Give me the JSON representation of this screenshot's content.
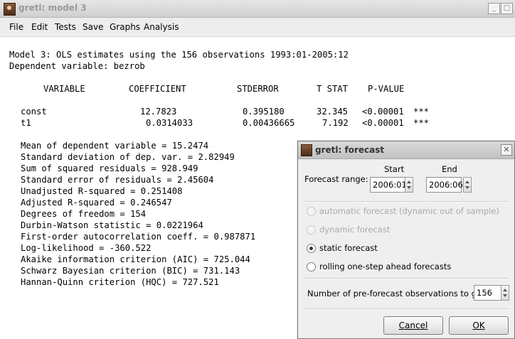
{
  "window": {
    "title": "gretl: model 3"
  },
  "menu": [
    "File",
    "Edit",
    "Tests",
    "Save",
    "Graphs",
    "Analysis"
  ],
  "output": {
    "header1": "Model 3: OLS estimates using the 156 observations 1993:01-2005:12",
    "header2": "Dependent variable: bezrob",
    "col_headers": [
      "VARIABLE",
      "COEFFICIENT",
      "STDERROR",
      "T STAT",
      "P-VALUE"
    ],
    "rows": [
      {
        "var": "const",
        "coef": "12.7823",
        "se": "0.395180",
        "t": "32.345",
        "p": "<0.00001",
        "sig": "***"
      },
      {
        "var": "t1",
        "coef": "0.0314033",
        "se": "0.00436665",
        "t": "7.192",
        "p": "<0.00001",
        "sig": "***"
      }
    ],
    "stats": [
      "Mean of dependent variable = 15.2474",
      "Standard deviation of dep. var. = 2.82949",
      "Sum of squared residuals = 928.949",
      "Standard error of residuals = 2.45604",
      "Unadjusted R-squared = 0.251408",
      "Adjusted R-squared = 0.246547",
      "Degrees of freedom = 154",
      "Durbin-Watson statistic = 0.0221964",
      "First-order autocorrelation coeff. = 0.987871",
      "Log-likelihood = -360.522",
      "Akaike information criterion (AIC) = 725.044",
      "Schwarz Bayesian criterion (BIC) = 731.143",
      "Hannan-Quinn criterion (HQC) = 727.521"
    ]
  },
  "dialog": {
    "title": "gretl: forecast",
    "range_label": "Forecast range:",
    "start_label": "Start",
    "end_label": "End",
    "start_value": "2006:01",
    "end_value": "2006:06",
    "options": [
      {
        "label": "automatic forecast (dynamic out of sample)",
        "enabled": false,
        "checked": false
      },
      {
        "label": "dynamic forecast",
        "enabled": false,
        "checked": false
      },
      {
        "label": "static forecast",
        "enabled": true,
        "checked": true
      },
      {
        "label": "rolling one-step ahead forecasts",
        "enabled": true,
        "checked": false
      }
    ],
    "preobs_label": "Number of pre-forecast observations to graph",
    "preobs_value": "156",
    "cancel_label": "Cancel",
    "ok_label": "OK"
  }
}
